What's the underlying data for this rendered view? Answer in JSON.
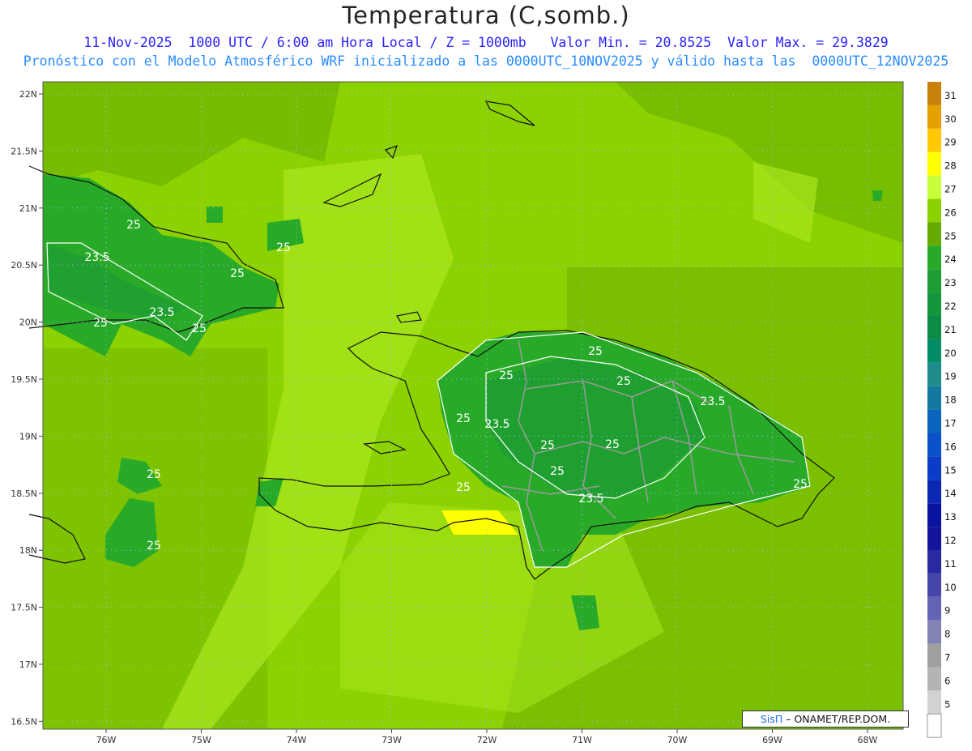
{
  "header": {
    "title": "Temperatura (C,somb.)",
    "subtitle_1": "11-Nov-2025  1000 UTC / 6:00 am Hora Local / Z = 1000mb   Valor Min. = 20.8525  Valor Max. = 29.3829",
    "subtitle_2": "Pronóstico con el Modelo Atmosférico WRF inicializado a las 0000UTC_10NOV2025 y válido hasta las  0000UTC_12NOV2025"
  },
  "map": {
    "lat_ticks": [
      "22N",
      "21.5N",
      "21N",
      "20.5N",
      "20N",
      "19.5N",
      "19N",
      "18.5N",
      "18N",
      "17.5N",
      "17N",
      "16.5N"
    ],
    "lon_ticks": [
      "76W",
      "75W",
      "74W",
      "73W",
      "72W",
      "71W",
      "70W",
      "69W",
      "68W"
    ],
    "contour_labels": [
      "25",
      "25",
      "23.5",
      "25",
      "23.5",
      "25",
      "25",
      "25",
      "25",
      "23.5",
      "25",
      "23.5",
      "25",
      "25",
      "25",
      "25",
      "23.5",
      "25",
      "25",
      "25",
      "25"
    ]
  },
  "colorbar": {
    "levels": [
      "31",
      "30",
      "29",
      "28",
      "27",
      "26",
      "25",
      "24",
      "23",
      "22",
      "21",
      "20",
      "19",
      "18",
      "17",
      "16",
      "15",
      "14",
      "13",
      "12",
      "11",
      "10",
      "9",
      "8",
      "7",
      "6",
      "5"
    ],
    "colors": [
      "#c8820a",
      "#e6a000",
      "#ffc800",
      "#ffff00",
      "#c8ff3c",
      "#8cd200",
      "#64aa00",
      "#28aa28",
      "#1e9e32",
      "#14963c",
      "#0a8c46",
      "#008c64",
      "#1e8c8c",
      "#1478a0",
      "#0a64be",
      "#0a50c8",
      "#0a3cc8",
      "#0a28b4",
      "#0a14a0",
      "#14149b",
      "#2a2aa0",
      "#4646aa",
      "#6464b4",
      "#8282b4",
      "#a0a0a0",
      "#b4b4b4",
      "#d2d2d2"
    ]
  },
  "credit": {
    "brand": "SisΠ",
    "text": "ONAMET/REP.DOM."
  }
}
